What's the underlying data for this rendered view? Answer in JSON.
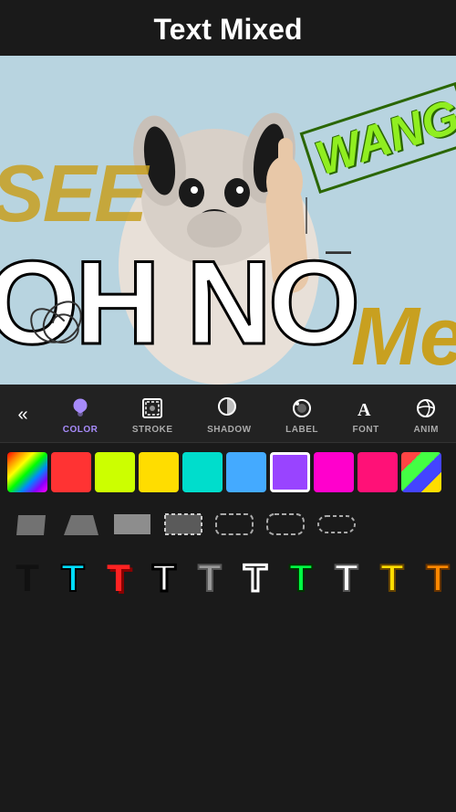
{
  "header": {
    "title": "Text Mixed"
  },
  "canvas": {
    "texts": {
      "see": "SEE",
      "wang": "WANG",
      "oh_no": "OH  NO",
      "dash": "—",
      "me": "Me"
    }
  },
  "toolbar": {
    "back_label": "«",
    "items": [
      {
        "id": "color",
        "label": "COLOR",
        "active": true
      },
      {
        "id": "stroke",
        "label": "STROKE",
        "active": false
      },
      {
        "id": "shadow",
        "label": "SHADOW",
        "active": false
      },
      {
        "id": "label",
        "label": "LABEL",
        "active": false
      },
      {
        "id": "font",
        "label": "FONT",
        "active": false
      },
      {
        "id": "anim",
        "label": "ANIM",
        "active": false
      }
    ]
  },
  "colors": [
    {
      "id": "rainbow",
      "type": "rainbow",
      "selected": false
    },
    {
      "id": "red",
      "hex": "#ff3333",
      "selected": false
    },
    {
      "id": "yellow-green",
      "hex": "#ccff00",
      "selected": false
    },
    {
      "id": "yellow",
      "hex": "#ffdd00",
      "selected": false
    },
    {
      "id": "teal",
      "hex": "#00ddcc",
      "selected": false
    },
    {
      "id": "sky",
      "hex": "#44aaff",
      "selected": false
    },
    {
      "id": "purple",
      "hex": "#9944ff",
      "selected": true
    },
    {
      "id": "magenta",
      "hex": "#ff00cc",
      "selected": false
    },
    {
      "id": "hot-pink",
      "hex": "#ff1177",
      "selected": false
    },
    {
      "id": "multicolor",
      "type": "multicolor",
      "selected": false
    }
  ],
  "shapes": [
    {
      "id": "parallelogram-1",
      "type": "parallelogram"
    },
    {
      "id": "trapezoid",
      "type": "trapezoid"
    },
    {
      "id": "rectangle",
      "type": "rectangle"
    },
    {
      "id": "dotted-rect",
      "type": "dotted-rect"
    },
    {
      "id": "rounded-dashed",
      "type": "rounded-dashed"
    },
    {
      "id": "rounded-rect",
      "type": "rounded-rect"
    },
    {
      "id": "pill",
      "type": "pill"
    }
  ],
  "letters": [
    {
      "id": "letter-black",
      "color": "#000000",
      "stroke": "#000000"
    },
    {
      "id": "letter-cyan",
      "color": "#00ddff",
      "stroke": "#000000"
    },
    {
      "id": "letter-red-shadow",
      "color": "#ff2222",
      "stroke": "#880000"
    },
    {
      "id": "letter-white-black",
      "color": "#ffffff",
      "stroke": "#000000"
    },
    {
      "id": "letter-gray",
      "color": "#888888",
      "stroke": "#444444"
    },
    {
      "id": "letter-white-outline",
      "color": "#ffffff",
      "stroke": "#ffffff"
    },
    {
      "id": "letter-green-outline",
      "color": "#00ff44",
      "stroke": "#004422"
    },
    {
      "id": "letter-white-stroke",
      "color": "#ffffff",
      "stroke": "#333333"
    },
    {
      "id": "letter-yellow",
      "color": "#ffdd00",
      "stroke": "#886600"
    },
    {
      "id": "letter-orange",
      "color": "#ff8800",
      "stroke": "#663300"
    }
  ]
}
